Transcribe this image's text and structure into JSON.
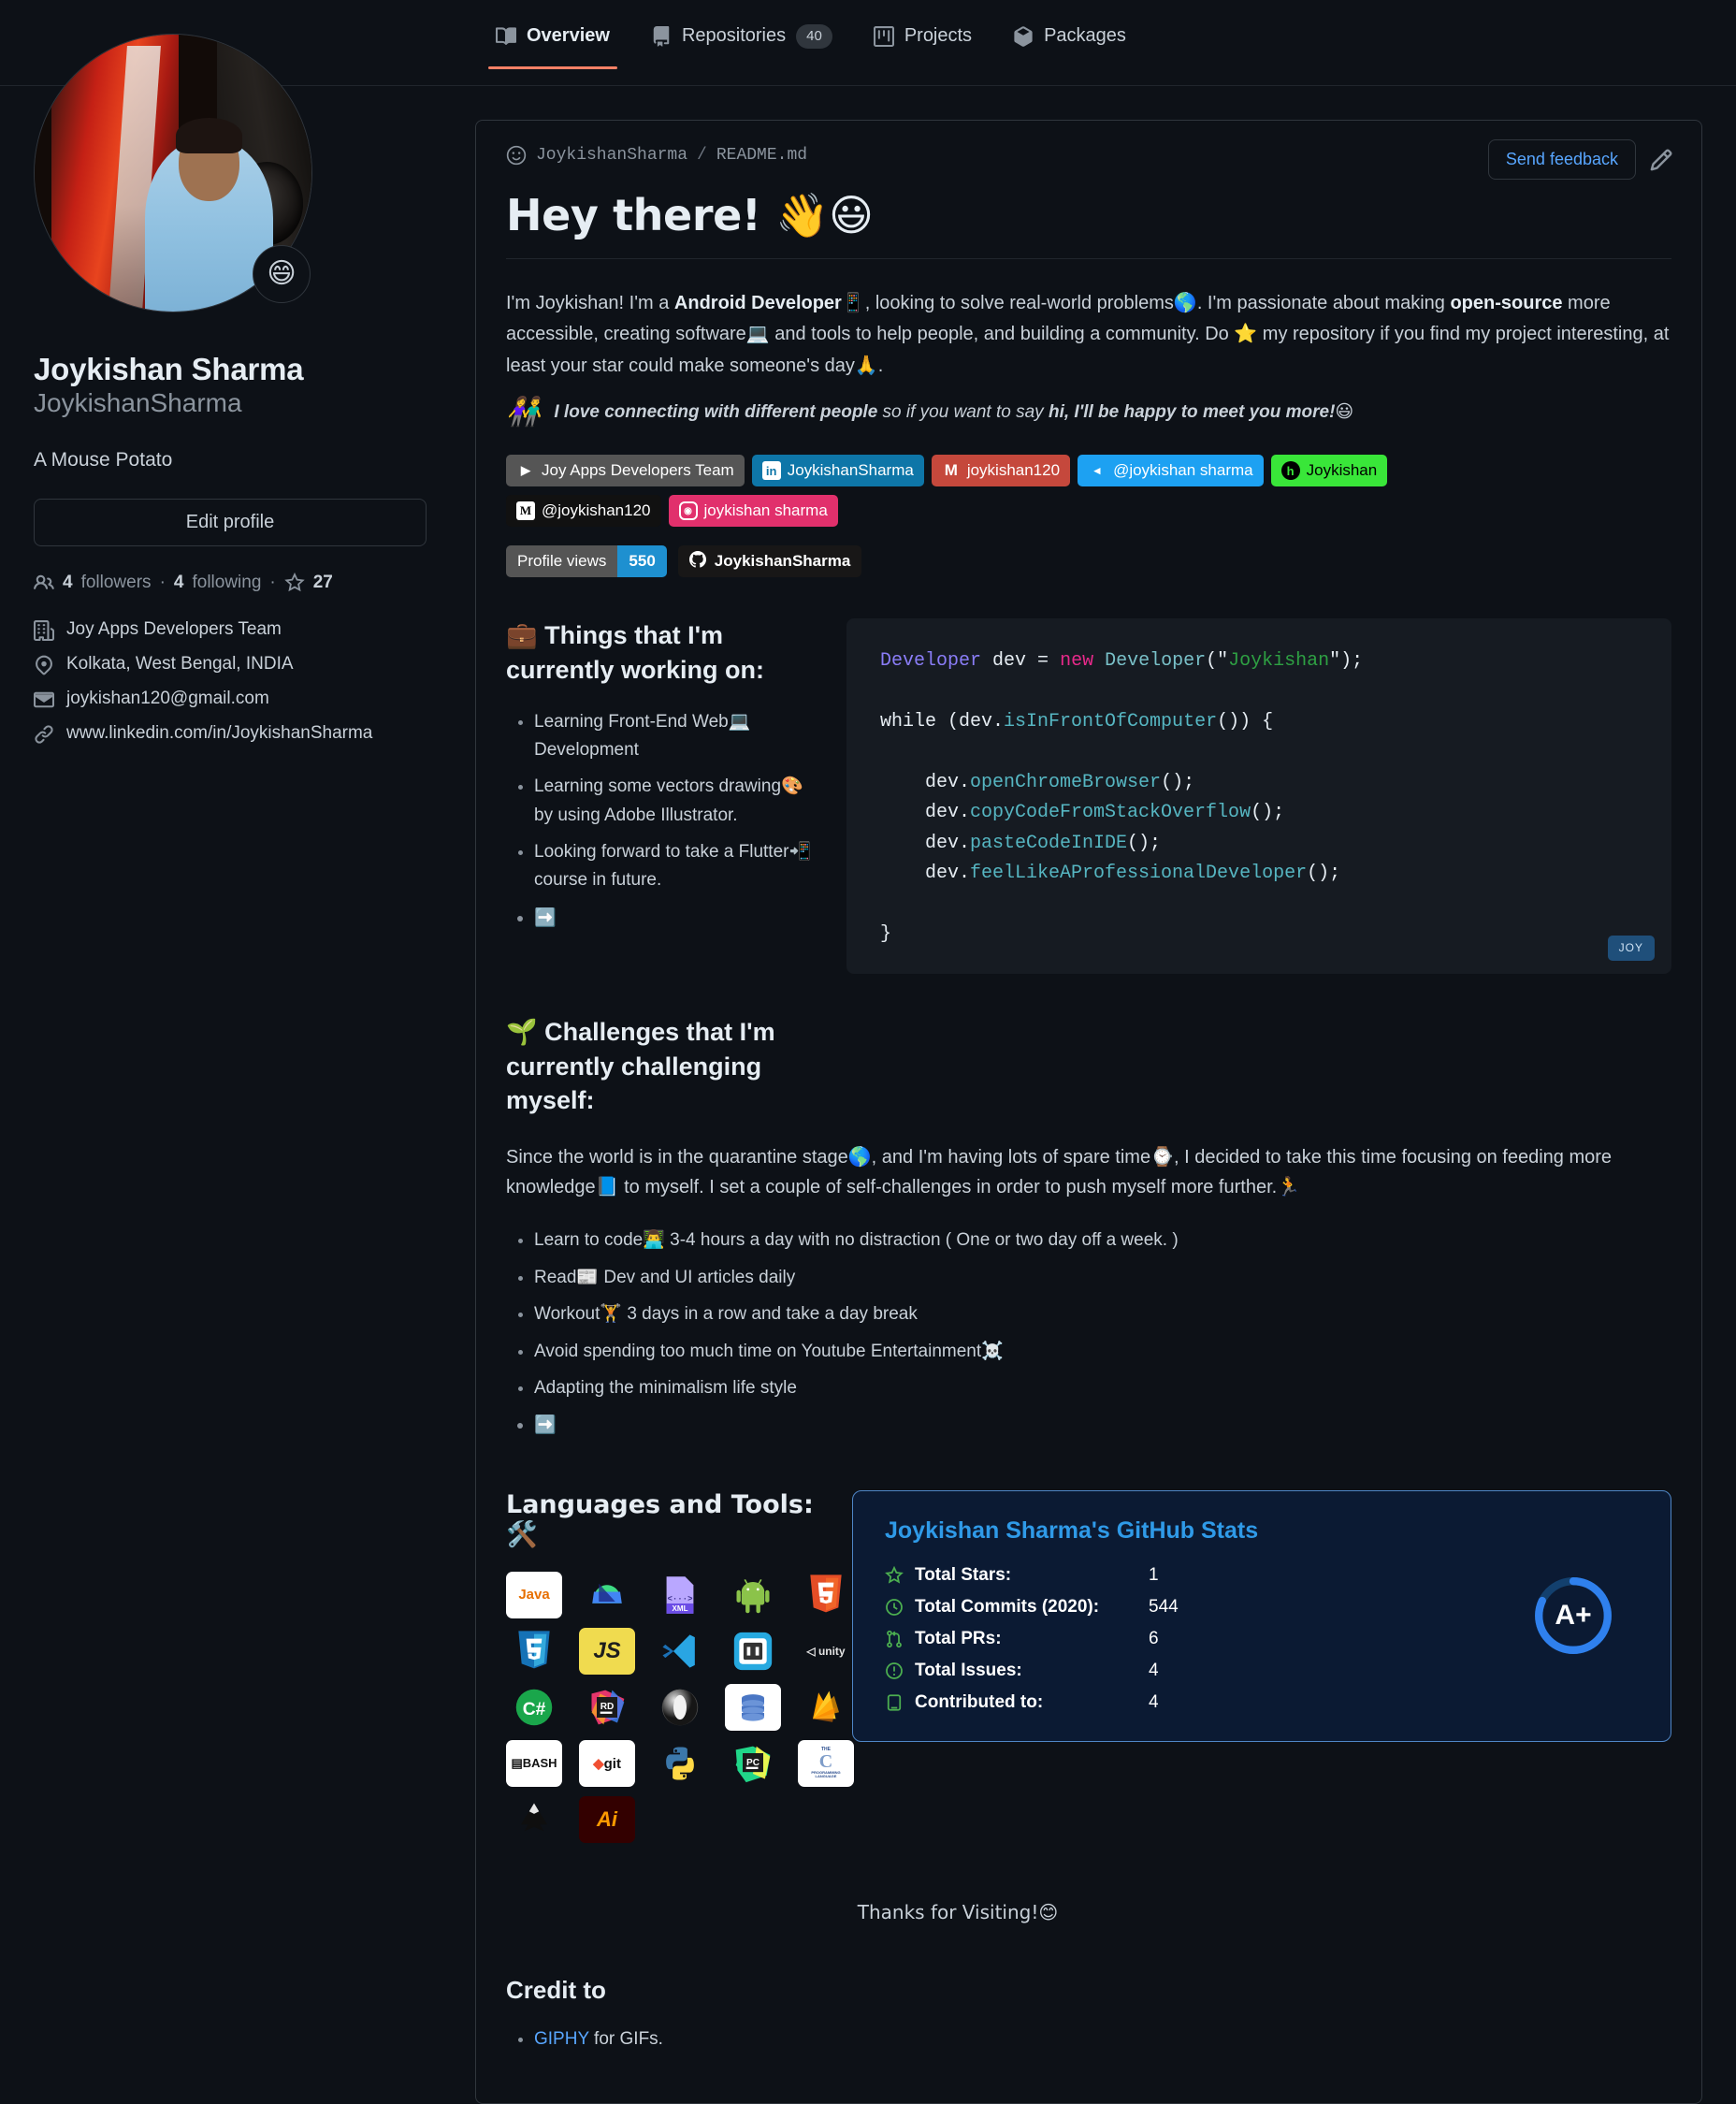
{
  "nav": {
    "tabs": [
      {
        "label": "Overview",
        "icon": "book-icon",
        "count": null,
        "active": true
      },
      {
        "label": "Repositories",
        "icon": "repo-icon",
        "count": "40",
        "active": false
      },
      {
        "label": "Projects",
        "icon": "project-icon",
        "count": null,
        "active": false
      },
      {
        "label": "Packages",
        "icon": "package-icon",
        "count": null,
        "active": false
      }
    ]
  },
  "sidebar": {
    "avatar_emoji": "😄",
    "name": "Joykishan Sharma",
    "login": "JoykishanSharma",
    "bio": "A Mouse Potato",
    "edit_button": "Edit profile",
    "followers_count": "4",
    "followers_label": "followers",
    "following_count": "4",
    "following_label": "following",
    "stars_count": "27",
    "details": [
      {
        "icon": "organization-icon",
        "text": "Joy Apps Developers Team"
      },
      {
        "icon": "location-icon",
        "text": "Kolkata, West Bengal, INDIA"
      },
      {
        "icon": "mail-icon",
        "text": "joykishan120@gmail.com"
      },
      {
        "icon": "link-icon",
        "text": "www.linkedin.com/in/JoykishanSharma"
      }
    ]
  },
  "readme": {
    "owner": "JoykishanSharma",
    "slash": "/",
    "file": "README.md",
    "feedback_button": "Send feedback",
    "heading": "Hey there! 👋😃",
    "intro_parts": {
      "p1": "I'm Joykishan! I'm a ",
      "b1": "Android Developer",
      "e1": "📱",
      "p2": ", looking to solve real-world problems",
      "e2": "🌎",
      "p3": ". I'm passionate about making ",
      "b2": "open-source",
      "p4": " more accessible, creating software",
      "e3": "💻",
      "p5": " and tools to help people, and building a community. Do ",
      "e4": "⭐",
      "p6": " my repository if you find my project interesting, at least your star could make someone's day",
      "e5": "🙏",
      "p7": "."
    },
    "quote": {
      "emoji": "👫",
      "bold1": "I love connecting with different people",
      "mid": " so if you want to say ",
      "bold2": "hi, I'll be happy to meet you more!",
      "end_emoji": "😃"
    },
    "badges": [
      {
        "label": "Joy Apps Developers Team",
        "bg": "#555555",
        "icon": "play-store-icon",
        "icon_bg": "transparent",
        "icon_color": "#ffffff",
        "glyph": "▶"
      },
      {
        "label": "JoykishanSharma",
        "bg": "#0e76a8",
        "icon": "linkedin-icon",
        "icon_bg": "#ffffff",
        "icon_color": "#0e76a8",
        "glyph": "in"
      },
      {
        "label": "joykishan120",
        "bg": "#c5483c",
        "icon": "gmail-icon",
        "icon_bg": "transparent",
        "icon_color": "#ffffff",
        "glyph": "M"
      },
      {
        "label": "@joykishan sharma",
        "bg": "#1da1f2",
        "icon": "telegram-icon",
        "icon_bg": "transparent",
        "icon_color": "#ffffff",
        "glyph": "◂"
      },
      {
        "label": "Joykishan",
        "bg": "#39e639",
        "icon": "hackerrank-icon",
        "icon_bg": "#000000",
        "icon_color": "#39e639",
        "glyph": "h"
      },
      {
        "label": "@joykishan120",
        "bg": "#111111",
        "icon": "medium-icon",
        "icon_bg": "#ffffff",
        "icon_color": "#000000",
        "glyph": "M"
      },
      {
        "label": "joykishan sharma",
        "bg": "#e1306c",
        "icon": "instagram-icon",
        "icon_bg": "transparent",
        "icon_color": "#ffffff",
        "glyph": "◎"
      }
    ],
    "profile_views": {
      "label": "Profile views",
      "value": "550"
    },
    "github_follow": {
      "label": "JoykishanSharma",
      "icon": "github-mark-icon"
    },
    "working": {
      "emoji": "💼",
      "title": "Things that I'm currently working on:",
      "items": [
        {
          "text": "Learning Front-End Web💻 Development"
        },
        {
          "text": "Learning some vectors drawing🎨 by using Adobe Illustrator."
        },
        {
          "text": "Looking forward to take a Flutter📲 course in future."
        },
        {
          "text": "➡️"
        }
      ]
    },
    "code": {
      "lines": [
        [
          {
            "t": "Developer ",
            "c": "c-type"
          },
          {
            "t": "dev ",
            "c": "c-var"
          },
          {
            "t": "= ",
            "c": "c-plain"
          },
          {
            "t": "new ",
            "c": "c-kw"
          },
          {
            "t": "Developer",
            "c": "c-cls"
          },
          {
            "t": "(\"",
            "c": "c-plain"
          },
          {
            "t": "Joykishan",
            "c": "c-str"
          },
          {
            "t": "\");",
            "c": "c-plain"
          }
        ],
        [],
        [
          {
            "t": "while ",
            "c": "c-plain"
          },
          {
            "t": "(dev.",
            "c": "c-plain"
          },
          {
            "t": "isInFrontOfComputer",
            "c": "c-fn"
          },
          {
            "t": "()) {",
            "c": "c-plain"
          }
        ],
        [],
        [
          {
            "t": "    dev.",
            "c": "c-plain"
          },
          {
            "t": "openChromeBrowser",
            "c": "c-fn"
          },
          {
            "t": "();",
            "c": "c-plain"
          }
        ],
        [
          {
            "t": "    dev.",
            "c": "c-plain"
          },
          {
            "t": "copyCodeFromStackOverflow",
            "c": "c-fn"
          },
          {
            "t": "();",
            "c": "c-plain"
          }
        ],
        [
          {
            "t": "    dev.",
            "c": "c-plain"
          },
          {
            "t": "pasteCodeInIDE",
            "c": "c-fn"
          },
          {
            "t": "();",
            "c": "c-plain"
          }
        ],
        [
          {
            "t": "    dev.",
            "c": "c-plain"
          },
          {
            "t": "feelLikeAProfessionalDeveloper",
            "c": "c-fn"
          },
          {
            "t": "();",
            "c": "c-plain"
          }
        ],
        [],
        [
          {
            "t": "}",
            "c": "c-plain"
          }
        ]
      ],
      "tag": "JOY"
    },
    "challenges": {
      "emoji": "🌱",
      "title": "Challenges that I'm currently challenging myself:",
      "paragraph": "Since the world is in the quarantine stage🌎, and I'm having lots of spare time⌚, I decided to take this time focusing on feeding more knowledge📘 to myself. I set a couple of self-challenges in order to push myself more further.🏃",
      "items": [
        {
          "text": "Learn to code👨‍💻 3-4 hours a day with no distraction ( One or two day off a week. )"
        },
        {
          "text": "Read📰 Dev and UI articles daily"
        },
        {
          "text": "Workout🏋️ 3 days in a row and take a day break"
        },
        {
          "text": "Avoid spending too much time on Youtube Entertainment☠️"
        },
        {
          "text": "Adapting the minimalism life style"
        },
        {
          "text": "➡️"
        }
      ]
    },
    "tools": {
      "title": "Languages and Tools: 🛠️",
      "items": [
        {
          "name": "java-icon",
          "label": "Java"
        },
        {
          "name": "android-studio-icon",
          "label": "Android Studio"
        },
        {
          "name": "xml-icon",
          "label": "XML"
        },
        {
          "name": "android-icon",
          "label": "Android"
        },
        {
          "name": "html5-icon",
          "label": "HTML5"
        },
        {
          "name": "css3-icon",
          "label": "CSS3"
        },
        {
          "name": "javascript-icon",
          "label": "JavaScript"
        },
        {
          "name": "vscode-icon",
          "label": "VS Code"
        },
        {
          "name": "brackets-icon",
          "label": "Brackets"
        },
        {
          "name": "unity-icon",
          "label": "Unity"
        },
        {
          "name": "csharp-icon",
          "label": "C#"
        },
        {
          "name": "rider-icon",
          "label": "Rider"
        },
        {
          "name": "opera-icon",
          "label": "Opera"
        },
        {
          "name": "sql-icon",
          "label": "SQL"
        },
        {
          "name": "firebase-icon",
          "label": "Firebase"
        },
        {
          "name": "bash-icon",
          "label": "Bash"
        },
        {
          "name": "git-icon",
          "label": "Git"
        },
        {
          "name": "python-icon",
          "label": "Python"
        },
        {
          "name": "pycharm-icon",
          "label": "PyCharm"
        },
        {
          "name": "c-language-icon",
          "label": "C"
        },
        {
          "name": "inkscape-icon",
          "label": "Inkscape"
        },
        {
          "name": "illustrator-icon",
          "label": "Adobe Illustrator"
        }
      ]
    },
    "thanks": "Thanks for Visiting!😊",
    "credit_title": "Credit to",
    "credit_items": [
      {
        "link": "GIPHY",
        "rest": " for GIFs."
      }
    ]
  },
  "chart_data": {
    "type": "table",
    "title": "Joykishan Sharma's GitHub Stats",
    "rank": "A+",
    "rank_percent": 82,
    "rows": [
      {
        "icon": "star-icon",
        "label": "Total Stars:",
        "value": "1"
      },
      {
        "icon": "commit-icon",
        "label": "Total Commits (2020):",
        "value": "544"
      },
      {
        "icon": "pr-icon",
        "label": "Total PRs:",
        "value": "6"
      },
      {
        "icon": "issue-icon",
        "label": "Total Issues:",
        "value": "4"
      },
      {
        "icon": "contributed-icon",
        "label": "Contributed to:",
        "value": "4"
      }
    ],
    "colors": {
      "title": "#2f9ae8",
      "icons": "#4caf50",
      "text": "#ffffff",
      "ring": "#2f80ed",
      "bg": "#0b1a33",
      "border": "#4f86c6"
    }
  }
}
